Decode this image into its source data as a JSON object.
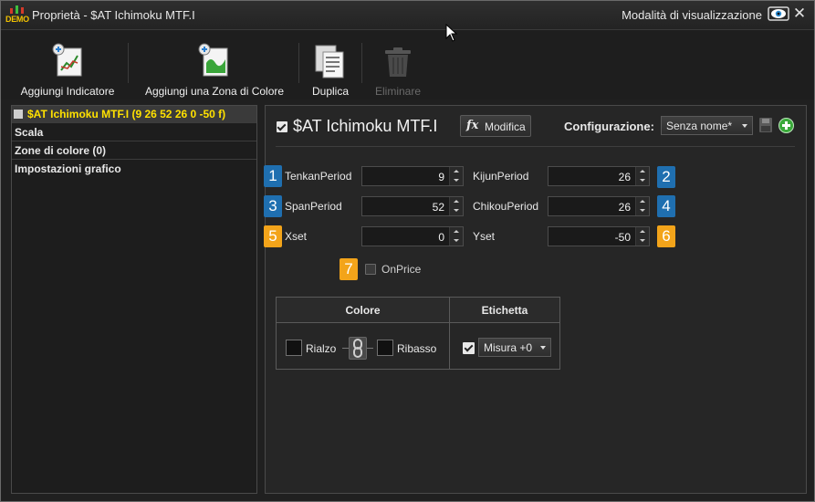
{
  "window": {
    "title": "Proprietà - $AT Ichimoku MTF.I",
    "demo_label": "DEMO",
    "view_mode": "Modalità di visualizzazione"
  },
  "toolbar": {
    "add_indicator": "Aggiungi Indicatore",
    "add_color_zone": "Aggiungi una Zona di Colore",
    "duplicate": "Duplica",
    "delete": "Eliminare"
  },
  "tree": {
    "items": [
      {
        "label": "$AT Ichimoku MTF.I (9 26 52 26 0 -50 f)",
        "selected": true
      },
      {
        "label": "Scala"
      },
      {
        "label": "Zone di colore (0)"
      },
      {
        "label": "Impostazioni grafico"
      }
    ]
  },
  "panel": {
    "indicator_name": "$AT Ichimoku MTF.I",
    "enabled": true,
    "modify_label": "Modifica",
    "modify_icon": "fx",
    "config_label": "Configurazione:",
    "config_value": "Senza nome*",
    "params": [
      {
        "badge": "1",
        "badge_color": "#1f6fb0",
        "label": "TenkanPeriod",
        "value": "9"
      },
      {
        "badge": "2",
        "badge_color": "#1f6fb0",
        "label": "KijunPeriod",
        "value": "26"
      },
      {
        "badge": "3",
        "badge_color": "#1f6fb0",
        "label": "SpanPeriod",
        "value": "52"
      },
      {
        "badge": "4",
        "badge_color": "#1f6fb0",
        "label": "ChikouPeriod",
        "value": "26"
      },
      {
        "badge": "5",
        "badge_color": "#f3a41a",
        "label": "Xset",
        "value": "0"
      },
      {
        "badge": "6",
        "badge_color": "#f3a41a",
        "label": "Yset",
        "value": "-50"
      }
    ],
    "onprice": {
      "badge": "7",
      "label": "OnPrice",
      "checked": false
    },
    "table": {
      "color_header": "Colore",
      "label_header": "Etichetta",
      "up_label": "Rialzo",
      "down_label": "Ribasso",
      "measure_value": "Misura +0",
      "measure_checked": true
    }
  }
}
